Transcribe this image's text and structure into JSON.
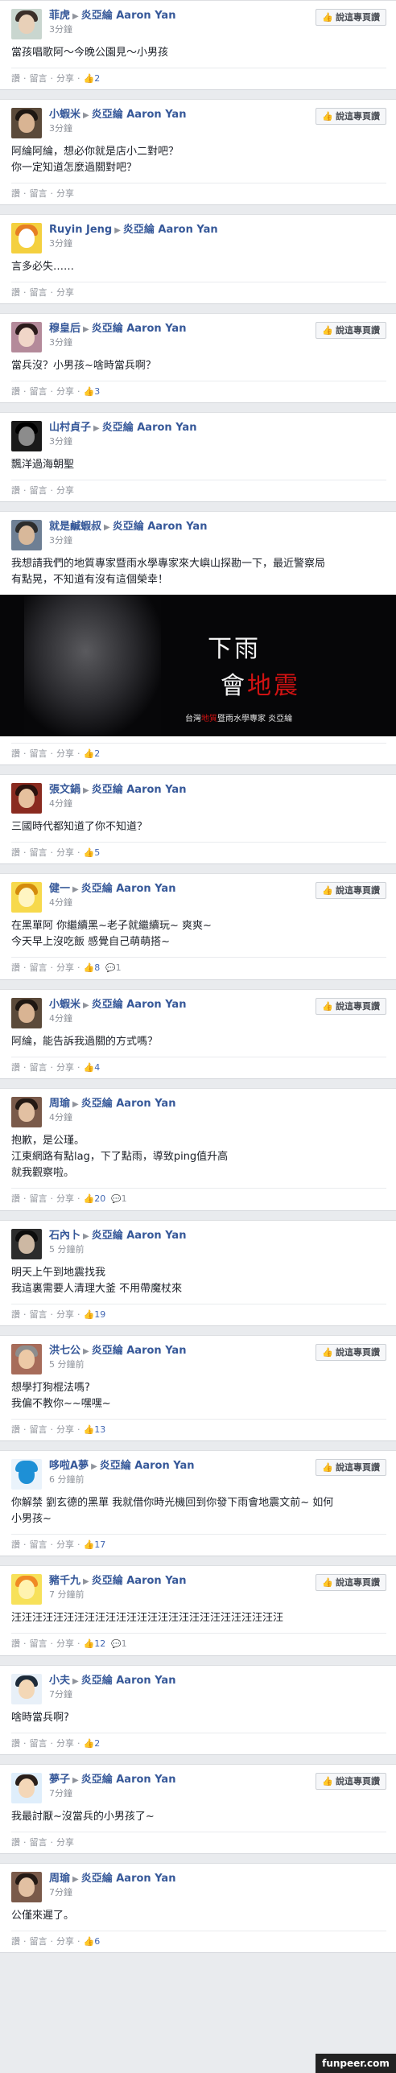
{
  "page_title": "Aaron Yan",
  "report_label": "說這專頁讚",
  "actions": {
    "like": "讚",
    "comment": "留言",
    "share": "分享"
  },
  "watermark": "funpeer.com",
  "posts": [
    {
      "author": "菲虎",
      "target": "炎亞綸 Aaron Yan",
      "time": "3分鐘",
      "lines": [
        "當孩唱歌阿～今晚公園見～小男孩"
      ],
      "likes": "2",
      "replies": "",
      "report": true,
      "avatar": {
        "bg": "#c9d6cf",
        "face": "#e8d0b8",
        "hair": "#3a2f2a"
      }
    },
    {
      "author": "小蝦米",
      "target": "炎亞綸 Aaron Yan",
      "time": "3分鐘",
      "lines": [
        "阿綸阿綸，想必你就是店小二對吧？",
        "你一定知道怎麼過關對吧？"
      ],
      "likes": "",
      "replies": "",
      "report": true,
      "avatar": {
        "bg": "#5b4a3a",
        "face": "#d9b493",
        "hair": "#1e1712"
      }
    },
    {
      "author": "Ruyin Jeng",
      "target": "炎亞綸 Aaron Yan",
      "time": "3分鐘",
      "lines": [
        "言多必失……"
      ],
      "likes": "",
      "replies": "",
      "report": false,
      "avatar": {
        "bg": "#f4d03f",
        "face": "#ffffff",
        "hair": "#e67e22"
      }
    },
    {
      "author": "穆皇后",
      "target": "炎亞綸 Aaron Yan",
      "time": "3分鐘",
      "lines": [
        "當兵沒？小男孩~啥時當兵啊？"
      ],
      "likes": "3",
      "replies": "",
      "report": true,
      "avatar": {
        "bg": "#b48a9a",
        "face": "#f0d6c8",
        "hair": "#2b1b1b"
      }
    },
    {
      "author": "山村貞子",
      "target": "炎亞綸 Aaron Yan",
      "time": "3分鐘",
      "lines": [
        "飄洋過海朝聖"
      ],
      "likes": "",
      "replies": "",
      "report": false,
      "avatar": {
        "bg": "#1a1a1a",
        "face": "#8c8c8c",
        "hair": "#000000"
      }
    },
    {
      "author": "就是鹹蝦叔",
      "target": "炎亞綸 Aaron Yan",
      "time": "3分鐘",
      "lines": [
        "我想請我們的地質專家暨雨水學專家來大嶼山探勘一下，最近警察局",
        "有點晃，不知道有沒有這個榮幸！"
      ],
      "likes": "2",
      "replies": "",
      "report": false,
      "image": true,
      "avatar": {
        "bg": "#6e7f94",
        "face": "#d8b89a",
        "hair": "#2d2d2d"
      }
    },
    {
      "author": "張文鍋",
      "target": "炎亞綸 Aaron Yan",
      "time": "4分鐘",
      "lines": [
        "三國時代都知道了你不知道？"
      ],
      "likes": "5",
      "replies": "",
      "report": false,
      "avatar": {
        "bg": "#8a2b20",
        "face": "#e6c19e",
        "hair": "#2a120d"
      }
    },
    {
      "author": "健一",
      "target": "炎亞綸 Aaron Yan",
      "time": "4分鐘",
      "lines": [
        "在黑單阿 你繼續黑~老子就繼續玩~ 爽爽~",
        "今天早上沒吃飯 感覺自己萌萌搭~"
      ],
      "likes": "8",
      "replies": "1",
      "report": true,
      "avatar": {
        "bg": "#f7d94c",
        "face": "#fff5c2",
        "hair": "#d48b0c"
      }
    },
    {
      "author": "小蝦米",
      "target": "炎亞綸 Aaron Yan",
      "time": "4分鐘",
      "lines": [
        "阿綸，能告訴我過關的方式嗎？"
      ],
      "likes": "4",
      "replies": "",
      "report": true,
      "avatar": {
        "bg": "#5b4a3a",
        "face": "#d9b493",
        "hair": "#1e1712"
      }
    },
    {
      "author": "周瑜",
      "target": "炎亞綸 Aaron Yan",
      "time": "4分鐘",
      "lines": [
        "抱歉，是公瑾。",
        "江東網路有點lag，下了點雨，導致ping值升高",
        "就我觀察啦。"
      ],
      "likes": "20",
      "replies": "1",
      "report": false,
      "avatar": {
        "bg": "#7a5a4a",
        "face": "#e2c0a2",
        "hair": "#241914"
      }
    },
    {
      "author": "石內卜",
      "target": "炎亞綸 Aaron Yan",
      "time": "5 分鐘前",
      "lines": [
        "明天上午到地震找我",
        "我這裏需要人清理大釜 不用帶魔杖來"
      ],
      "likes": "19",
      "replies": "",
      "report": false,
      "avatar": {
        "bg": "#2c2c2c",
        "face": "#cdb8a3",
        "hair": "#0d0d0d"
      }
    },
    {
      "author": "洪七公",
      "target": "炎亞綸 Aaron Yan",
      "time": "5 分鐘前",
      "lines": [
        "想學打狗棍法嗎?",
        "我偏不教你~~嘿嘿~"
      ],
      "likes": "13",
      "replies": "",
      "report": true,
      "avatar": {
        "bg": "#a76c5a",
        "face": "#ecc9a6",
        "hair": "#8d8d8d"
      }
    },
    {
      "author": "哆啦A夢",
      "target": "炎亞綸 Aaron Yan",
      "time": "6 分鐘前",
      "lines": [
        "你解禁 劉玄德的黑單 我就借你時光機回到你發下雨會地震文前~ 如何",
        "小男孩~"
      ],
      "likes": "17",
      "replies": "",
      "report": true,
      "avatar": {
        "bg": "#eaf3fb",
        "face": "#1e90d6",
        "hair": "#1e90d6"
      }
    },
    {
      "author": "豬千九",
      "target": "炎亞綸 Aaron Yan",
      "time": "7 分鐘前",
      "lines": [
        "汪汪汪汪汪汪汪汪汪汪汪汪汪汪汪汪汪汪汪汪汪汪汪汪汪汪"
      ],
      "likes": "12",
      "replies": "1",
      "report": true,
      "avatar": {
        "bg": "#f7e15a",
        "face": "#fff3b0",
        "hair": "#f08a24"
      }
    },
    {
      "author": "小夫",
      "target": "炎亞綸 Aaron Yan",
      "time": "7分鐘",
      "lines": [
        "啥時當兵啊?"
      ],
      "likes": "2",
      "replies": "",
      "report": false,
      "avatar": {
        "bg": "#e8f0f8",
        "face": "#f3d7b6",
        "hair": "#1d2b3a"
      }
    },
    {
      "author": "夢子",
      "target": "炎亞綸 Aaron Yan",
      "time": "7分鐘",
      "lines": [
        "我最討厭~沒當兵的小男孩了~"
      ],
      "likes": "",
      "replies": "",
      "report": true,
      "avatar": {
        "bg": "#dfeefb",
        "face": "#f4d7b8",
        "hair": "#2a1f1a"
      }
    },
    {
      "author": "周瑜",
      "target": "炎亞綸 Aaron Yan",
      "time": "7分鐘",
      "lines": [
        "公僅來遲了。"
      ],
      "likes": "6",
      "replies": "",
      "report": false,
      "avatar": {
        "bg": "#7a5a4a",
        "face": "#e2c0a2",
        "hair": "#241914"
      }
    }
  ],
  "image_text": {
    "line1": "下雨",
    "line2_a": "會",
    "line2_b": "地震",
    "caption_a": "台灣",
    "caption_b": "地質",
    "caption_c": "暨雨水學專家 炎亞綸"
  }
}
